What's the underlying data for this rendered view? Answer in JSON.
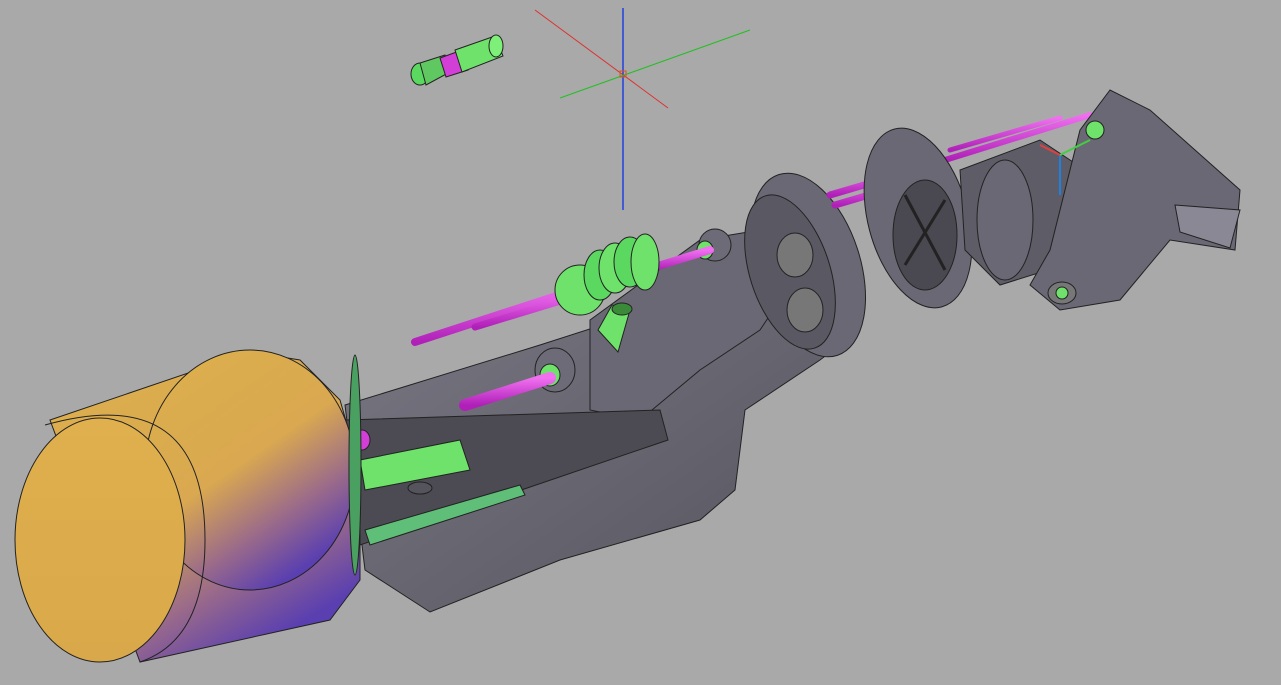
{
  "viewport": {
    "background": "#a9a9a9",
    "view_mode": "3D shaded"
  },
  "colors": {
    "body_gray": "#5e5c66",
    "body_light": "#7a7884",
    "rod_magenta": "#d23fd6",
    "part_green": "#6ee26a",
    "cylinder_top": "#ddb04c",
    "cylinder_bottom": "#5a3fb0",
    "axis_x": "#e03030",
    "axis_y": "#20c020",
    "axis_z": "#2040e0"
  },
  "icons": [
    "crosshair-cursor-icon",
    "ucs-icon"
  ]
}
